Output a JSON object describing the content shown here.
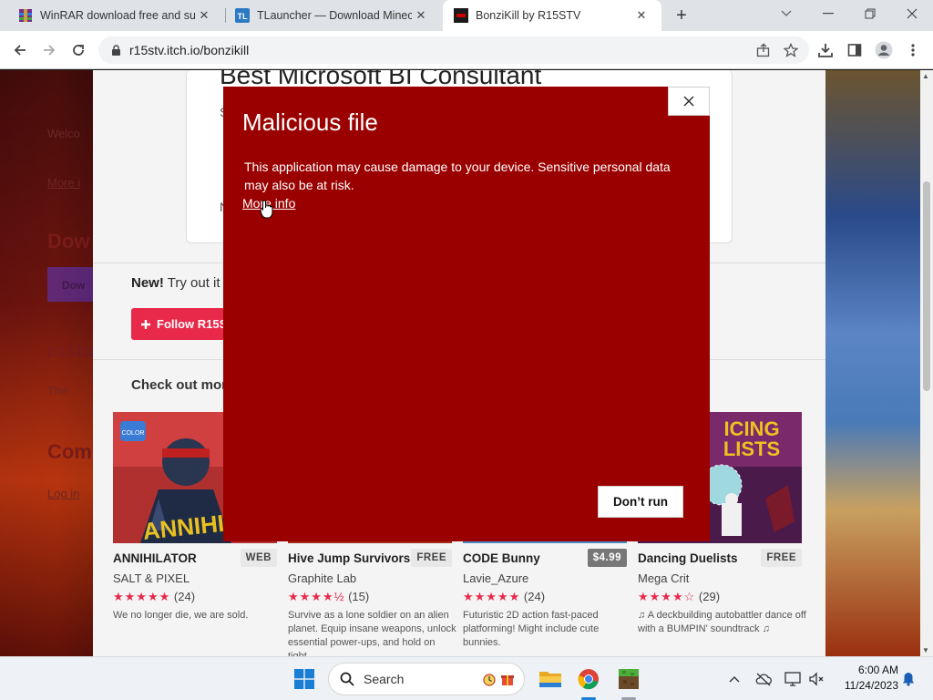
{
  "browser": {
    "tabs": [
      {
        "title": "WinRAR download free and sup",
        "active": false
      },
      {
        "title": "TLauncher — Download Minecr",
        "active": false
      },
      {
        "title": "BonziKill by R15STV",
        "active": true
      }
    ],
    "url": "r15stv.itch.io/bonzikill"
  },
  "page": {
    "ad_title": "Best Microsoft BI Consultant",
    "ad_s": "S",
    "ad_n": "N",
    "new_bold": "New!",
    "new_text": "Try out it",
    "follow_label": "Follow R15S",
    "check_more": "Check out more",
    "left_ghosts": [
      "Welco",
      "More i",
      "Dow",
      "Dow",
      "Insta",
      "The",
      "Com",
      "Log in"
    ],
    "games": [
      {
        "title": "ANNIHILATOR",
        "badge": "WEB",
        "author": "SALT & PIXEL",
        "stars": "★★★★★",
        "count": "(24)",
        "desc": "We no longer die, we are sold."
      },
      {
        "title": "Hive Jump Survivors",
        "badge": "FREE",
        "author": "Graphite Lab",
        "stars": "★★★★½",
        "count": "(15)",
        "desc": "Survive as a lone soldier on an alien planet. Equip insane weapons, unlock essential power-ups, and hold on tight..."
      },
      {
        "title": "CODE Bunny",
        "badge": "$4.99",
        "author": "Lavie_Azure",
        "stars": "★★★★★",
        "count": "(24)",
        "desc": "Futuristic 2D action fast-paced platforming! Might include cute bunnies."
      },
      {
        "title": "Dancing Duelists",
        "badge": "FREE",
        "author": "Mega Crit",
        "stars": "★★★★☆",
        "count": "(29)",
        "desc": "♫ A deckbuilding autobattler dance off with a BUMPIN' soundtrack ♫"
      }
    ]
  },
  "dialog": {
    "title": "Malicious file",
    "message": "This application may cause damage to your device. Sensitive personal data may also be at risk.",
    "more_info": "More info",
    "dont_run": "Don’t run",
    "bg_color": "#9a0000"
  },
  "taskbar": {
    "search_label": "Search",
    "time": "6:00 AM",
    "date": "11/24/2023"
  }
}
